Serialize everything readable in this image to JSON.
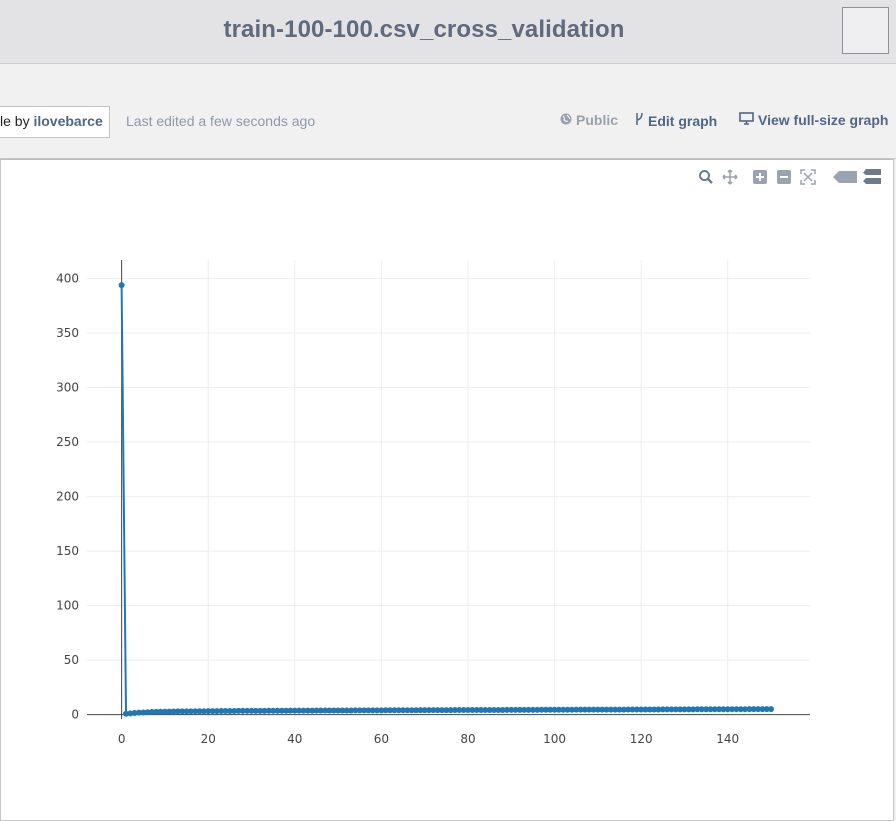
{
  "header": {
    "title": "train-100-100.csv_cross_validation"
  },
  "info": {
    "credit_prefix": "le by",
    "credit_user": "ilovebarce",
    "last_edited": "Last edited a few seconds ago",
    "public_label": "Public",
    "edit_graph_label": "Edit graph",
    "view_full_label": "View full-size graph"
  },
  "modebar": {
    "icons": [
      "zoom-icon",
      "pan-icon",
      "zoom-in-icon",
      "zoom-out-icon",
      "autoscale-icon",
      "hover-closest-icon",
      "hover-compare-icon"
    ]
  },
  "chart_data": {
    "type": "line",
    "title": "",
    "xlabel": "",
    "ylabel": "",
    "xlim": [
      -8,
      159
    ],
    "ylim": [
      -4,
      417
    ],
    "x_ticks": [
      0,
      20,
      40,
      60,
      80,
      100,
      120,
      140
    ],
    "y_ticks": [
      0,
      50,
      100,
      150,
      200,
      250,
      300,
      350,
      400
    ],
    "grid": true,
    "line_color": "#1f77b4",
    "series": [
      {
        "x": [
          0,
          1,
          2,
          3,
          4,
          5,
          6,
          7,
          8,
          9,
          10,
          11,
          12,
          13,
          14,
          15,
          16,
          17,
          18,
          19,
          20,
          21,
          22,
          23,
          24,
          25,
          26,
          27,
          28,
          29,
          30,
          31,
          32,
          33,
          34,
          35,
          36,
          37,
          38,
          39,
          40,
          41,
          42,
          43,
          44,
          45,
          46,
          47,
          48,
          49,
          50,
          51,
          52,
          53,
          54,
          55,
          56,
          57,
          58,
          59,
          60,
          61,
          62,
          63,
          64,
          65,
          66,
          67,
          68,
          69,
          70,
          71,
          72,
          73,
          74,
          75,
          76,
          77,
          78,
          79,
          80,
          81,
          82,
          83,
          84,
          85,
          86,
          87,
          88,
          89,
          90,
          91,
          92,
          93,
          94,
          95,
          96,
          97,
          98,
          99,
          100,
          101,
          102,
          103,
          104,
          105,
          106,
          107,
          108,
          109,
          110,
          111,
          112,
          113,
          114,
          115,
          116,
          117,
          118,
          119,
          120,
          121,
          122,
          123,
          124,
          125,
          126,
          127,
          128,
          129,
          130,
          131,
          132,
          133,
          134,
          135,
          136,
          137,
          138,
          139,
          140,
          141,
          142,
          143,
          144,
          145,
          146,
          147,
          148,
          149,
          150
        ],
        "y": [
          394,
          0.8,
          1.2,
          1.5,
          1.8,
          2,
          2.2,
          2.4,
          2.5,
          2.6,
          2.7,
          2.8,
          2.9,
          2.95,
          3,
          3,
          3.05,
          3.1,
          3.1,
          3.15,
          3.2,
          3.2,
          3.25,
          3.3,
          3.3,
          3.3,
          3.35,
          3.4,
          3.4,
          3.4,
          3.45,
          3.5,
          3.5,
          3.5,
          3.55,
          3.55,
          3.6,
          3.6,
          3.6,
          3.65,
          3.65,
          3.7,
          3.7,
          3.7,
          3.7,
          3.75,
          3.75,
          3.8,
          3.8,
          3.8,
          3.8,
          3.85,
          3.85,
          3.85,
          3.9,
          3.9,
          3.9,
          3.9,
          3.95,
          3.95,
          3.95,
          4,
          4,
          4,
          4,
          4.05,
          4.05,
          4.05,
          4.05,
          4.1,
          4.1,
          4.1,
          4.1,
          4.15,
          4.15,
          4.15,
          4.15,
          4.2,
          4.2,
          4.2,
          4.2,
          4.25,
          4.25,
          4.25,
          4.25,
          4.3,
          4.3,
          4.3,
          4.3,
          4.35,
          4.35,
          4.35,
          4.35,
          4.4,
          4.4,
          4.4,
          4.4,
          4.45,
          4.45,
          4.45,
          4.45,
          4.5,
          4.5,
          4.5,
          4.5,
          4.55,
          4.55,
          4.55,
          4.55,
          4.6,
          4.6,
          4.6,
          4.6,
          4.65,
          4.65,
          4.65,
          4.65,
          4.7,
          4.7,
          4.7,
          4.7,
          4.75,
          4.75,
          4.75,
          4.75,
          4.8,
          4.8,
          4.8,
          4.8,
          4.85,
          4.85,
          4.85,
          4.85,
          4.9,
          4.9,
          4.9,
          4.9,
          4.95,
          4.95,
          4.95,
          4.95,
          5,
          5,
          5,
          5,
          5.05,
          5.05,
          5.05,
          5.05,
          5.1,
          5.1
        ]
      }
    ]
  }
}
